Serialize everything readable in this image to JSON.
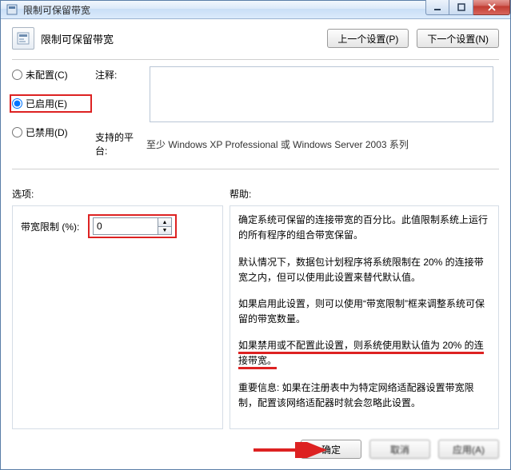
{
  "window": {
    "title": "限制可保留带宽"
  },
  "heading": "限制可保留带宽",
  "nav": {
    "prev": "上一个设置(P)",
    "next": "下一个设置(N)"
  },
  "radios": {
    "not_configured": "未配置(C)",
    "enabled": "已启用(E)",
    "disabled": "已禁用(D)",
    "selected": "enabled"
  },
  "labels": {
    "comment": "注释:",
    "platform": "支持的平台:",
    "options": "选项:",
    "help": "帮助:",
    "bandwidth_limit": "带宽限制 (%):"
  },
  "platform_value": "至少 Windows XP Professional 或 Windows Server 2003 系列",
  "spinner_value": "0",
  "help_paragraphs": {
    "p1": "确定系统可保留的连接带宽的百分比。此值限制系统上运行的所有程序的组合带宽保留。",
    "p2": "默认情况下，数据包计划程序将系统限制在 20% 的连接带宽之内，但可以使用此设置来替代默认值。",
    "p3": "如果启用此设置，则可以使用“带宽限制”框来调整系统可保留的带宽数量。",
    "p4": "如果禁用或不配置此设置，则系统使用默认值为 20% 的连接带宽。",
    "p5": "重要信息: 如果在注册表中为特定网络适配器设置带宽限制，配置该网络适配器时就会忽略此设置。"
  },
  "footer": {
    "ok": "确定",
    "cancel": "取消",
    "apply": "应用(A)"
  }
}
